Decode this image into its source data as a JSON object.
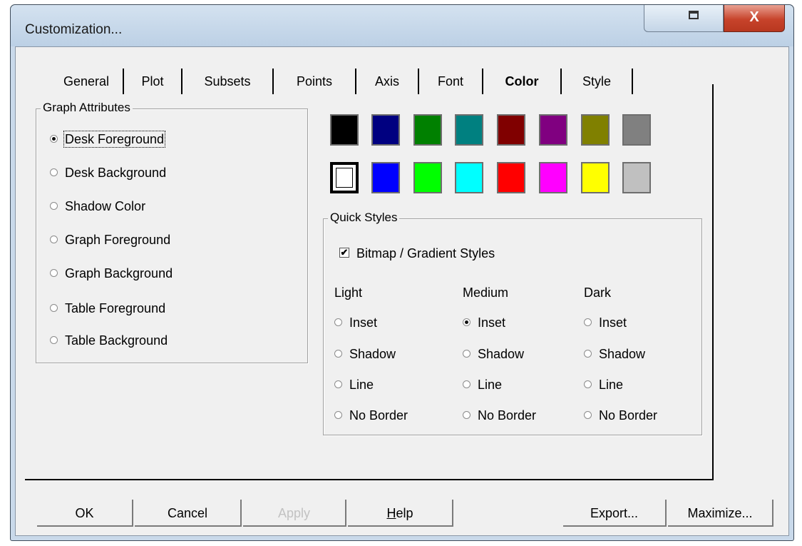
{
  "window": {
    "title": "Customization...",
    "close_label": "X"
  },
  "tabs": [
    {
      "label": "General",
      "active": false
    },
    {
      "label": "Plot",
      "active": false
    },
    {
      "label": "Subsets",
      "active": false
    },
    {
      "label": "Points",
      "active": false
    },
    {
      "label": "Axis",
      "active": false
    },
    {
      "label": "Font",
      "active": false
    },
    {
      "label": "Color",
      "active": true
    },
    {
      "label": "Style",
      "active": false
    }
  ],
  "graph_attributes": {
    "legend": "Graph Attributes",
    "selected": "Desk Foreground",
    "options": [
      "Desk Foreground",
      "Desk Background",
      "Shadow Color",
      "Graph Foreground",
      "Graph Background",
      "Table Foreground",
      "Table Background"
    ]
  },
  "palette": {
    "row1": [
      "#000000",
      "#000080",
      "#008000",
      "#008080",
      "#800000",
      "#800080",
      "#808000",
      "#808080"
    ],
    "row2": [
      "#ffffff",
      "#0000ff",
      "#00ff00",
      "#00ffff",
      "#ff0000",
      "#ff00ff",
      "#ffff00",
      "#c0c0c0"
    ],
    "selected": "#ffffff"
  },
  "quick_styles": {
    "legend": "Quick Styles",
    "checkbox_label": "Bitmap / Gradient Styles",
    "checkbox_checked": true,
    "checkmark": "✔",
    "columns": [
      {
        "header": "Light",
        "options": [
          "Inset",
          "Shadow",
          "Line",
          "No Border"
        ],
        "selected": null
      },
      {
        "header": "Medium",
        "options": [
          "Inset",
          "Shadow",
          "Line",
          "No Border"
        ],
        "selected": "Inset"
      },
      {
        "header": "Dark",
        "options": [
          "Inset",
          "Shadow",
          "Line",
          "No Border"
        ],
        "selected": null
      }
    ]
  },
  "buttons": {
    "ok": "OK",
    "cancel": "Cancel",
    "apply": "Apply",
    "help_prefix": "H",
    "help_rest": "elp",
    "export": "Export...",
    "maximize": "Maximize..."
  }
}
